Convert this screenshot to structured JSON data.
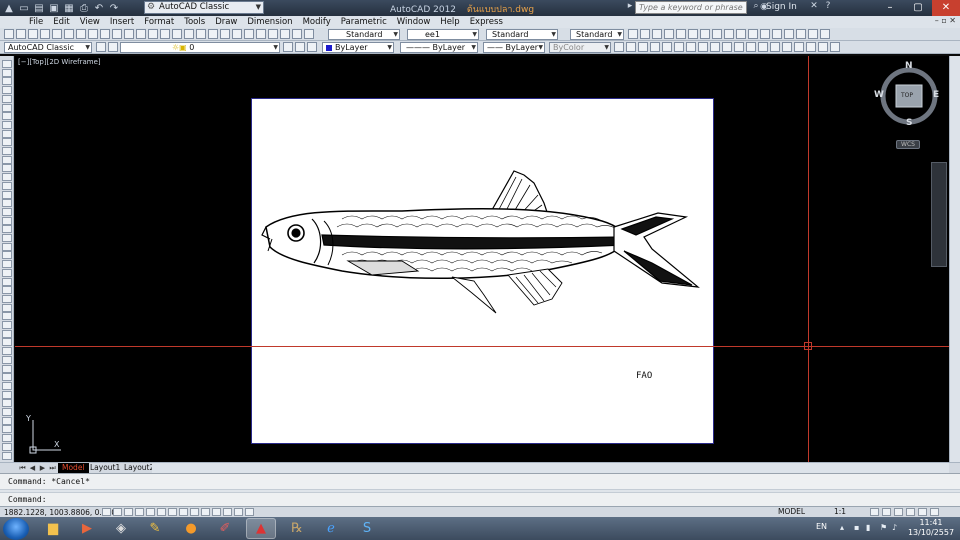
{
  "titlebar": {
    "workspace": "AutoCAD Classic",
    "app_title": "AutoCAD 2012",
    "file_name": "ต้นแบบปลา.dwg",
    "search_placeholder": "Type a keyword or phrase",
    "sign_in": "Sign In"
  },
  "menu": {
    "items": [
      "File",
      "Edit",
      "View",
      "Insert",
      "Format",
      "Tools",
      "Draw",
      "Dimension",
      "Modify",
      "Parametric",
      "Window",
      "Help",
      "Express"
    ]
  },
  "toolbar1": {
    "text_style": "Standard",
    "dim_style": "ee1",
    "table_style": "Standard",
    "mleader_style": "Standard"
  },
  "toolbar2": {
    "workspace": "AutoCAD Classic",
    "layer": "0",
    "color": "ByLayer",
    "linetype": "ByLayer",
    "lineweight": "ByLayer",
    "plotstyle": "ByColor"
  },
  "viewport": {
    "label": "[−][Top][2D Wireframe]",
    "image_caption": "FAO"
  },
  "viewcube": {
    "north": "N",
    "south": "S",
    "east": "E",
    "west": "W",
    "face": "TOP",
    "wcs": "WCS"
  },
  "ucs": {
    "y_label": "Y",
    "x_label": "X"
  },
  "layout_tabs": [
    "Model",
    "Layout1",
    "Layout2"
  ],
  "command": {
    "history": "Command: *Cancel*",
    "prompt": "Command:"
  },
  "status": {
    "coordinates": "1882.1228, 1003.8806, 0.0000",
    "model": "MODEL",
    "annotation_scale": "1:1"
  },
  "taskbar": {
    "language": "EN",
    "time": "11:41",
    "date": "13/10/2557"
  },
  "colors": {
    "crosshair": "#c0392b",
    "model_space_bg": "#000000",
    "title_accent": "#e8a24a"
  }
}
